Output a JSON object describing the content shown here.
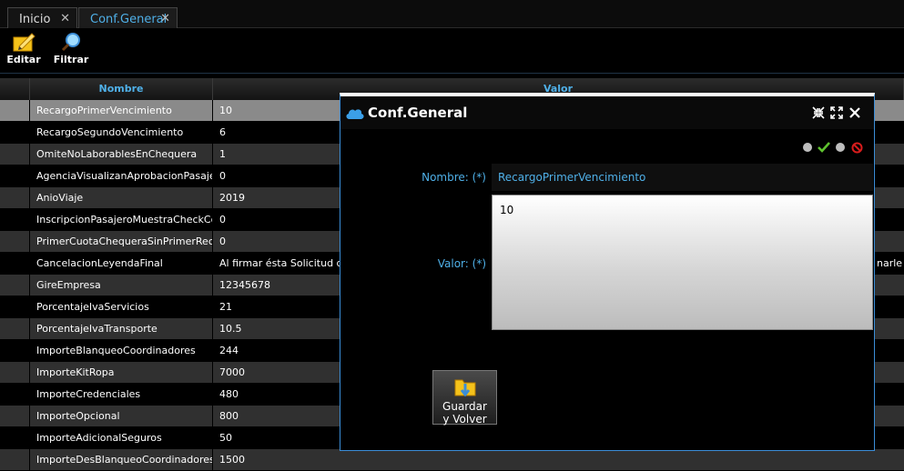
{
  "tabs": [
    {
      "label": "Inicio",
      "close": "✕"
    },
    {
      "label": "Conf.General",
      "close": "✕"
    }
  ],
  "toolbar": {
    "edit_label": "Editar",
    "filter_label": "Filtrar"
  },
  "grid": {
    "headers": [
      "Nombre",
      "Valor"
    ],
    "rows": [
      {
        "name": "RecargoPrimerVencimiento",
        "value": "10"
      },
      {
        "name": "RecargoSegundoVencimiento",
        "value": "6"
      },
      {
        "name": "OmiteNoLaborablesEnChequera",
        "value": "1"
      },
      {
        "name": "AgenciaVisualizanAprobacionPasajero",
        "value": "0"
      },
      {
        "name": "AnioViaje",
        "value": "2019"
      },
      {
        "name": "InscripcionPasajeroMuestraCheckCond",
        "value": "0"
      },
      {
        "name": "PrimerCuotaChequeraSinPrimerRecargo",
        "value": "0"
      },
      {
        "name": "CancelacionLeyendaFinal",
        "value": "Al firmar ésta Solicitud de R",
        "trail": "narle a"
      },
      {
        "name": "GireEmpresa",
        "value": "12345678"
      },
      {
        "name": "PorcentajeIvaServicios",
        "value": "21"
      },
      {
        "name": "PorcentajeIvaTransporte",
        "value": "10.5"
      },
      {
        "name": "ImporteBlanqueoCoordinadores",
        "value": "244"
      },
      {
        "name": "ImporteKitRopa",
        "value": "7000"
      },
      {
        "name": "ImporteCredenciales",
        "value": "480"
      },
      {
        "name": "ImporteOpcional",
        "value": "800"
      },
      {
        "name": "ImporteAdicionalSeguros",
        "value": "50"
      },
      {
        "name": "ImporteDesBlanqueoCoordinadores",
        "value": "1500"
      }
    ]
  },
  "dialog": {
    "title": "Conf.General",
    "nombre_label": "Nombre: (*)",
    "nombre_value": "RecargoPrimerVencimiento",
    "valor_label": "Valor: (*)",
    "valor_value": "10",
    "save_label_1": "Guardar",
    "save_label_2": "y Volver"
  },
  "colors": {
    "accent": "#4fb0e8",
    "dialog_border": "#3b8ed8",
    "ok": "#5fc22f",
    "cancel": "#d81c1c"
  }
}
